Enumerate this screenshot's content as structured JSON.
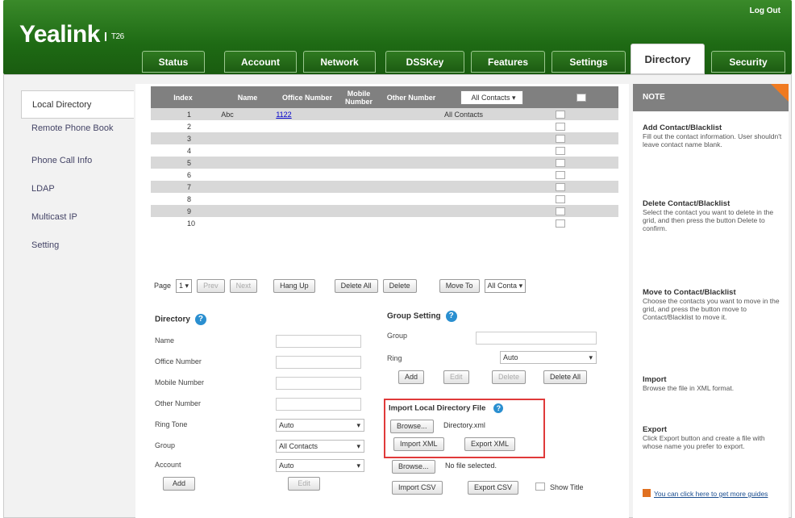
{
  "brand": {
    "name": "Yealink",
    "model": "T26"
  },
  "header": {
    "logout": "Log Out"
  },
  "tabs": [
    "Status",
    "Account",
    "Network",
    "DSSKey",
    "Features",
    "Settings",
    "Directory",
    "Security"
  ],
  "sidebar": {
    "items": [
      "Local Directory",
      "Remote Phone Book",
      "Phone Call Info",
      "LDAP",
      "Multicast IP",
      "Setting"
    ]
  },
  "grid": {
    "headers": {
      "index": "Index",
      "name": "Name",
      "office": "Office Number",
      "mobile": "Mobile Number",
      "other": "Other Number",
      "group_filter": "All Contacts"
    },
    "rows": [
      {
        "index": "1",
        "name": "Abc",
        "office": "1122",
        "group": "All Contacts"
      },
      {
        "index": "2",
        "name": "",
        "office": "",
        "group": ""
      },
      {
        "index": "3",
        "name": "",
        "office": "",
        "group": ""
      },
      {
        "index": "4",
        "name": "",
        "office": "",
        "group": ""
      },
      {
        "index": "5",
        "name": "",
        "office": "",
        "group": ""
      },
      {
        "index": "6",
        "name": "",
        "office": "",
        "group": ""
      },
      {
        "index": "7",
        "name": "",
        "office": "",
        "group": ""
      },
      {
        "index": "8",
        "name": "",
        "office": "",
        "group": ""
      },
      {
        "index": "9",
        "name": "",
        "office": "",
        "group": ""
      },
      {
        "index": "10",
        "name": "",
        "office": "",
        "group": ""
      }
    ]
  },
  "pager": {
    "page_label": "Page",
    "page_value": "1",
    "prev": "Prev",
    "next": "Next",
    "hang_up": "Hang Up",
    "delete_all": "Delete All",
    "delete": "Delete",
    "move_to": "Move To",
    "move_target": "All Conta"
  },
  "directory": {
    "title": "Directory",
    "fields": {
      "name": "Name",
      "office": "Office Number",
      "mobile": "Mobile Number",
      "other": "Other Number",
      "ring_tone": "Ring Tone",
      "group": "Group",
      "account": "Account"
    },
    "ring_tone_value": "Auto",
    "group_value": "All Contacts",
    "account_value": "Auto",
    "add": "Add",
    "edit": "Edit"
  },
  "group_setting": {
    "title": "Group Setting",
    "group_label": "Group",
    "ring_label": "Ring",
    "ring_value": "Auto",
    "add": "Add",
    "edit": "Edit",
    "delete": "Delete",
    "delete_all": "Delete All"
  },
  "import": {
    "title": "Import Local Directory File",
    "browse": "Browse...",
    "file": "Directory.xml",
    "import_xml": "Import XML",
    "export_xml": "Export XML",
    "browse2": "Browse...",
    "no_file": "No file selected.",
    "import_csv": "Import CSV",
    "export_csv": "Export CSV",
    "show_title": "Show Title"
  },
  "note": {
    "title": "NOTE",
    "sections": [
      {
        "title": "Add Contact/Blacklist",
        "text": "Fill out the contact information. User shouldn't leave contact name blank."
      },
      {
        "title": "Delete Contact/Blacklist",
        "text": "Select the contact you want to delete in the grid, and then press the button Delete to confirm."
      },
      {
        "title": "Move to Contact/Blacklist",
        "text": "Choose the contacts you want to move in the grid, and press the button move to Contact/Blacklist to move it."
      },
      {
        "title": "Import",
        "text": "Browse the file in XML format."
      },
      {
        "title": "Export",
        "text": "Click Export button and create a file with whose name you prefer to export."
      }
    ],
    "guide_text": "You can click here to get more guides"
  }
}
